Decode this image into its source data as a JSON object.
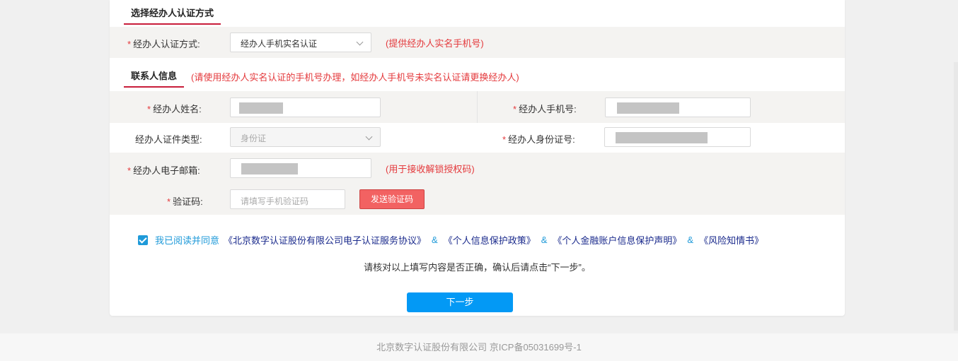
{
  "section_auth": {
    "title": "选择经办人认证方式",
    "method_label": "经办人认证方式:",
    "method_value": "经办人手机实名认证",
    "method_hint": "(提供经办人实名手机号)"
  },
  "section_contact": {
    "title": "联系人信息",
    "notice": "(请使用经办人实名认证的手机号办理，如经办人手机号未实名认证请更换经办人)",
    "name_label": "经办人姓名:",
    "phone_label": "经办人手机号:",
    "id_type_label": "经办人证件类型:",
    "id_type_value": "身份证",
    "id_no_label": "经办人身份证号:",
    "email_label": "经办人电子邮箱:",
    "email_hint": "(用于接收解锁授权码)",
    "code_label": "验证码:",
    "code_placeholder": "请填写手机验证码",
    "send_code_label": "发送验证码"
  },
  "required_mark": "*",
  "agreement": {
    "checked": true,
    "prefix": "我已阅读并同意",
    "docs": [
      "《北京数字认证股份有限公司电子认证服务协议》",
      "《个人信息保护政策》",
      "《个人金融账户信息保护声明》",
      "《风险知情书》"
    ],
    "separator": "&"
  },
  "confirm_text": "请核对以上填写内容是否正确，确认后请点击“下一步”。",
  "next_label": "下一步",
  "footer_text": "北京数字认证股份有限公司 京ICP备05031699号-1",
  "colors": {
    "accent_red": "#e4393c",
    "tab_underline": "#c81d3a",
    "primary_blue": "#0399f5",
    "link_blue": "#1f9ad9",
    "doc_blue": "#1a2a8c"
  }
}
